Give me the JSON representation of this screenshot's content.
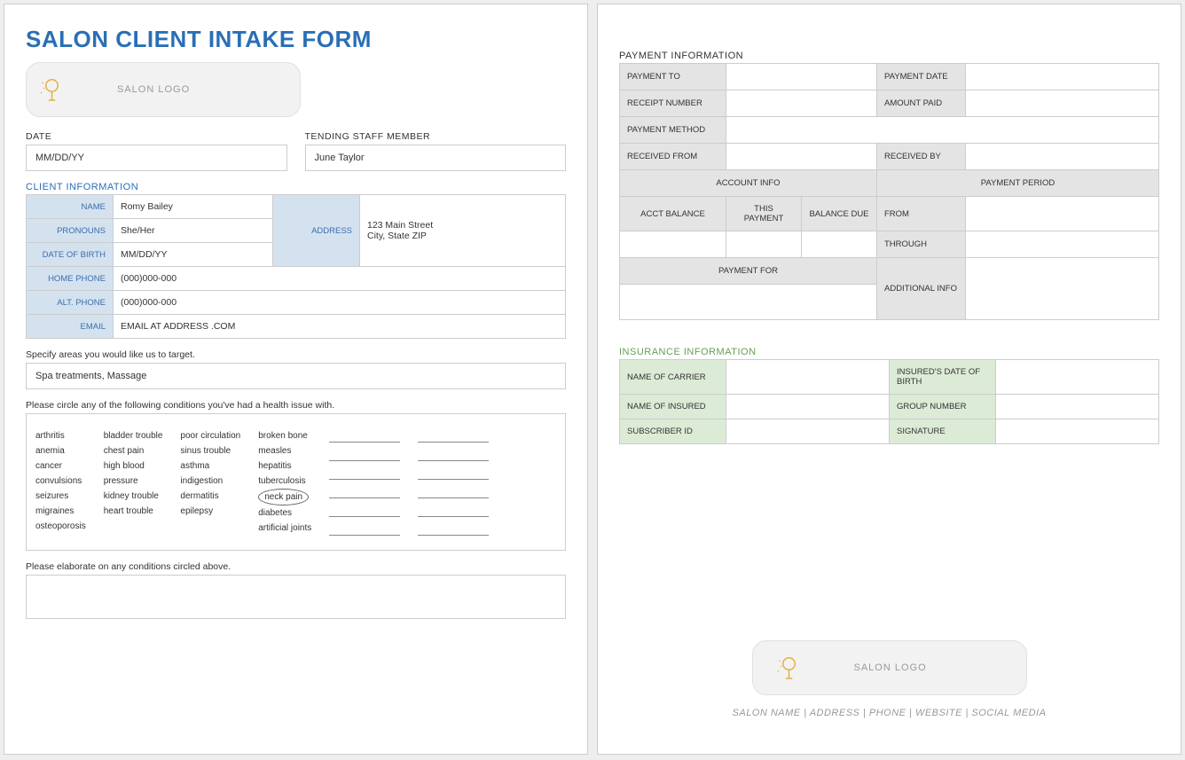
{
  "title": "SALON CLIENT INTAKE FORM",
  "logo_text": "SALON LOGO",
  "fields": {
    "date_label": "DATE",
    "date_value": "MM/DD/YY",
    "staff_label": "TENDING STAFF MEMBER",
    "staff_value": "June Taylor"
  },
  "client": {
    "section_title": "CLIENT INFORMATION",
    "name_label": "NAME",
    "name_value": "Romy Bailey",
    "pronouns_label": "PRONOUNS",
    "pronouns_value": "She/Her",
    "dob_label": "DATE OF BIRTH",
    "dob_value": "MM/DD/YY",
    "address_label": "ADDRESS",
    "address_line1": "123 Main Street",
    "address_line2": "City, State ZIP",
    "homephone_label": "HOME PHONE",
    "homephone_value": "(000)000-000",
    "altphone_label": "ALT. PHONE",
    "altphone_value": "(000)000-000",
    "email_label": "EMAIL",
    "email_value": "EMAIL AT ADDRESS .COM"
  },
  "target": {
    "prompt": "Specify areas you would like us to target.",
    "value": "Spa treatments, Massage"
  },
  "conditions": {
    "prompt": "Please circle any of the following conditions you've had a health issue with.",
    "col1": [
      "arthritis",
      "anemia",
      "cancer",
      "convulsions",
      "seizures",
      "migraines",
      "osteoporosis"
    ],
    "col2": [
      "bladder trouble",
      "chest pain",
      "high blood",
      "pressure",
      "kidney trouble",
      "heart trouble"
    ],
    "col3": [
      "poor circulation",
      "sinus trouble",
      "asthma",
      "indigestion",
      "dermatitis",
      "epilepsy"
    ],
    "col4": [
      "broken bone",
      "measles",
      "hepatitis",
      "tuberculosis",
      "neck pain",
      "diabetes",
      "artificial joints"
    ],
    "circled": "neck pain"
  },
  "elaborate_prompt": "Please elaborate on any conditions circled above.",
  "payment": {
    "section_title": "PAYMENT INFORMATION",
    "payment_to": "PAYMENT TO",
    "payment_date": "PAYMENT DATE",
    "receipt_number": "RECEIPT NUMBER",
    "amount_paid": "AMOUNT PAID",
    "payment_method": "PAYMENT METHOD",
    "received_from": "RECEIVED FROM",
    "received_by": "RECEIVED BY",
    "account_info": "ACCOUNT INFO",
    "payment_period": "PAYMENT PERIOD",
    "acct_balance": "ACCT BALANCE",
    "this_payment": "THIS PAYMENT",
    "balance_due": "BALANCE DUE",
    "from": "FROM",
    "through": "THROUGH",
    "payment_for": "PAYMENT FOR",
    "additional_info": "ADDITIONAL INFO"
  },
  "insurance": {
    "section_title": "INSURANCE INFORMATION",
    "name_of_carrier": "NAME OF CARRIER",
    "insured_dob": "INSURED'S DATE OF BIRTH",
    "name_of_insured": "NAME OF INSURED",
    "group_number": "GROUP NUMBER",
    "subscriber_id": "SUBSCRIBER ID",
    "signature": "SIGNATURE"
  },
  "footer": "SALON NAME  |  ADDRESS  |  PHONE  |  WEBSITE  |  SOCIAL MEDIA"
}
